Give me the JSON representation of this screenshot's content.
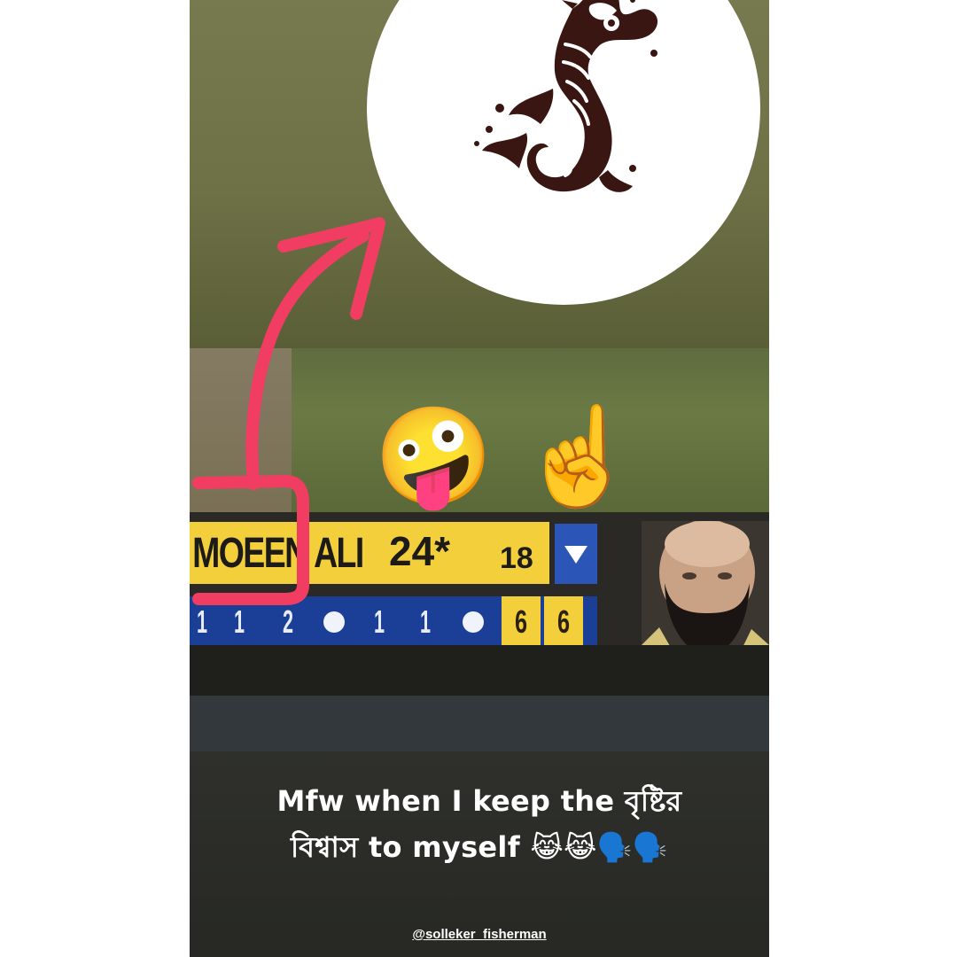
{
  "story": {
    "caption_line1": "Mfw when I keep the বৃষ্টির",
    "caption_line2": "বিশ্বাস to myself 😹😹🗣️🗣️",
    "username": "@solleker_fisherman"
  },
  "scoreboard": {
    "player_name": "MOEEN ALI",
    "runs": "24*",
    "balls": "18",
    "ball_by_ball": [
      "1",
      "1",
      "2",
      "•",
      "1",
      "1",
      "•",
      "6",
      "6"
    ]
  },
  "stickers": {
    "zany_face": "🤪",
    "pointing_up": "☝️"
  },
  "icons": {
    "profile_logo": "seahorse-icon",
    "dropdown": "chevron-down-icon",
    "annotation_arrow": "arrow-icon"
  },
  "colors": {
    "annotation": "#f23d63",
    "score_yellow": "#f3cf3b",
    "score_blue": "#1b3e96"
  }
}
